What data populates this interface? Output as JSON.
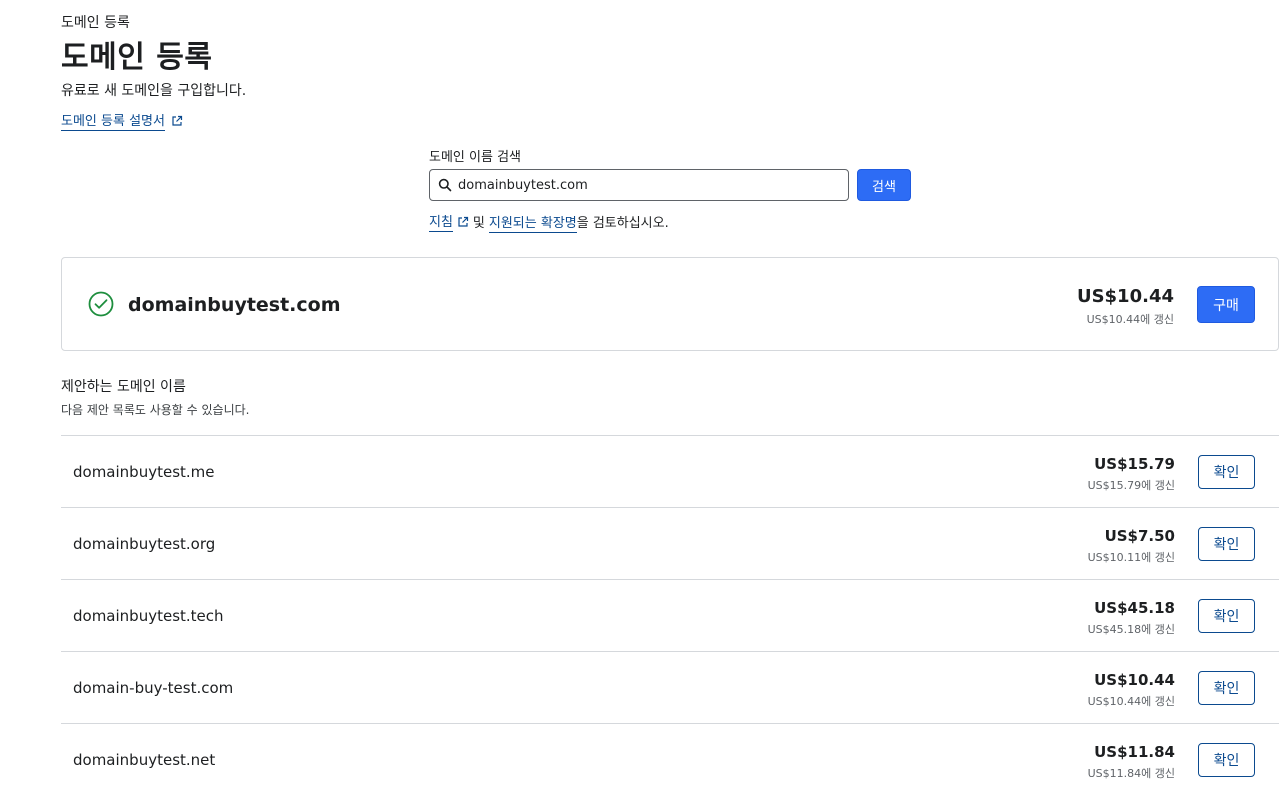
{
  "header": {
    "breadcrumb": "도메인 등록",
    "title": "도메인 등록",
    "subtitle": "유료로 새 도메인을 구입합니다.",
    "guide_link": "도메인 등록 설명서"
  },
  "search": {
    "label": "도메인 이름 검색",
    "value": "domainbuytest.com",
    "button_label": "검색",
    "hint_link1": "지침",
    "hint_mid": "및",
    "hint_link2": "지원되는 확장명",
    "hint_suffix": "을 검토하십시오."
  },
  "result": {
    "domain": "domainbuytest.com",
    "price": "US$10.44",
    "renew": "US$10.44에 갱신",
    "buy_label": "구매"
  },
  "suggestions": {
    "title": "제안하는 도메인 이름",
    "subtitle": "다음 제안 목록도 사용할 수 있습니다.",
    "items": [
      {
        "domain": "domainbuytest.me",
        "price": "US$15.79",
        "renew": "US$15.79에 갱신",
        "button": "확인"
      },
      {
        "domain": "domainbuytest.org",
        "price": "US$7.50",
        "renew": "US$10.11에 갱신",
        "button": "확인"
      },
      {
        "domain": "domainbuytest.tech",
        "price": "US$45.18",
        "renew": "US$45.18에 갱신",
        "button": "확인"
      },
      {
        "domain": "domain-buy-test.com",
        "price": "US$10.44",
        "renew": "US$10.44에 갱신",
        "button": "확인"
      },
      {
        "domain": "domainbuytest.net",
        "price": "US$11.84",
        "renew": "US$11.84에 갱신",
        "button": "확인"
      }
    ]
  },
  "colors": {
    "primary": "#2d6cf5",
    "link": "#0b4a8f",
    "success": "#1e8e3e",
    "border": "#d5d8dc"
  }
}
